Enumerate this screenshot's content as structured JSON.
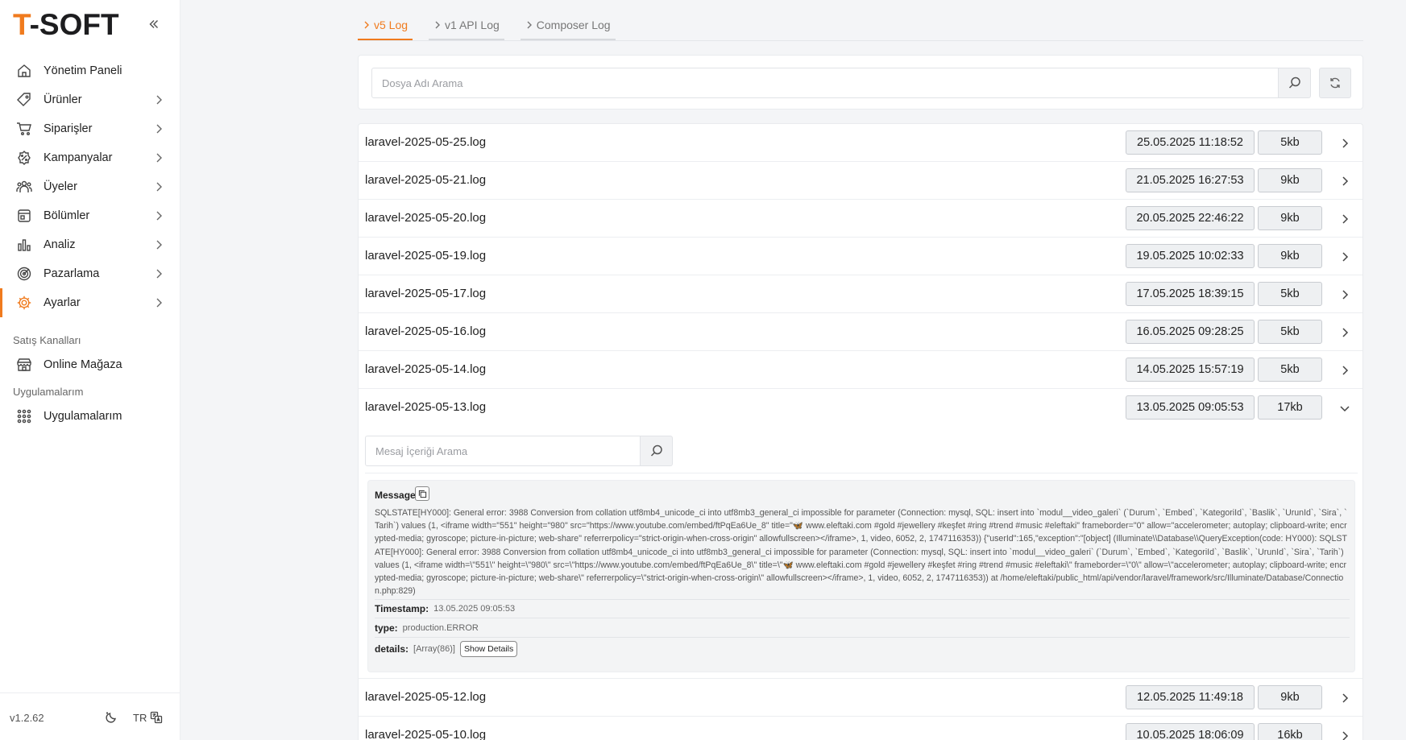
{
  "brand": {
    "logo_accent": "T",
    "logo_rest": "-SOFT",
    "accent_color": "#f07b1e"
  },
  "sidebar": {
    "items": [
      {
        "label": "Yönetim Paneli",
        "icon": "home-icon",
        "has_children": false
      },
      {
        "label": "Ürünler",
        "icon": "tag-icon",
        "has_children": true
      },
      {
        "label": "Siparişler",
        "icon": "cart-icon",
        "has_children": true
      },
      {
        "label": "Kampanyalar",
        "icon": "discount-icon",
        "has_children": true
      },
      {
        "label": "Üyeler",
        "icon": "users-icon",
        "has_children": true
      },
      {
        "label": "Bölümler",
        "icon": "sections-icon",
        "has_children": true
      },
      {
        "label": "Analiz",
        "icon": "chart-icon",
        "has_children": true
      },
      {
        "label": "Pazarlama",
        "icon": "target-icon",
        "has_children": true
      },
      {
        "label": "Ayarlar",
        "icon": "gear-icon",
        "has_children": true,
        "active": true
      }
    ],
    "sales_channels_label": "Satış Kanalları",
    "online_store_label": "Online Mağaza",
    "apps_section_label": "Uygulamalarım",
    "apps_item_label": "Uygulamalarım",
    "version": "v1.2.62",
    "language": "TR"
  },
  "tabs": [
    {
      "label": "v5 Log",
      "active": true
    },
    {
      "label": "v1 API Log",
      "active": false
    },
    {
      "label": "Composer Log",
      "active": false
    }
  ],
  "search": {
    "placeholder": "Dosya Adı Arama"
  },
  "logs": [
    {
      "name": "laravel-2025-05-25.log",
      "date": "25.05.2025 11:18:52",
      "size": "5kb"
    },
    {
      "name": "laravel-2025-05-21.log",
      "date": "21.05.2025 16:27:53",
      "size": "9kb"
    },
    {
      "name": "laravel-2025-05-20.log",
      "date": "20.05.2025 22:46:22",
      "size": "9kb"
    },
    {
      "name": "laravel-2025-05-19.log",
      "date": "19.05.2025 10:02:33",
      "size": "9kb"
    },
    {
      "name": "laravel-2025-05-17.log",
      "date": "17.05.2025 18:39:15",
      "size": "5kb"
    },
    {
      "name": "laravel-2025-05-16.log",
      "date": "16.05.2025 09:28:25",
      "size": "5kb"
    },
    {
      "name": "laravel-2025-05-14.log",
      "date": "14.05.2025 15:57:19",
      "size": "5kb"
    },
    {
      "name": "laravel-2025-05-13.log",
      "date": "13.05.2025 09:05:53",
      "size": "17kb",
      "expanded": true
    },
    {
      "name": "laravel-2025-05-12.log",
      "date": "12.05.2025 11:49:18",
      "size": "9kb"
    },
    {
      "name": "laravel-2025-05-10.log",
      "date": "10.05.2025 18:06:09",
      "size": "16kb"
    }
  ],
  "expanded_entry": {
    "search_placeholder": "Mesaj İçeriği Arama",
    "message_label": "Message",
    "message": "SQLSTATE[HY000]: General error: 3988 Conversion from collation utf8mb4_unicode_ci into utf8mb3_general_ci impossible for parameter (Connection: mysql, SQL: insert into `modul__video_galeri` (`Durum`, `Embed`, `KategoriId`, `Baslik`, `UrunId`, `Sira`, `Tarih`) values (1, <iframe width=\"551\" height=\"980\" src=\"https://www.youtube.com/embed/ftPqEa6Ue_8\" title=\"🦋 www.eleftaki.com #gold #jewellery #keşfet #ring #trend #music #eleftaki\" frameborder=\"0\" allow=\"accelerometer; autoplay; clipboard-write; encrypted-media; gyroscope; picture-in-picture; web-share\" referrerpolicy=\"strict-origin-when-cross-origin\" allowfullscreen></iframe>, 1, video, 6052, 2, 1747116353)) {\"userId\":165,\"exception\":\"[object] (Illuminate\\\\Database\\\\QueryException(code: HY000): SQLSTATE[HY000]: General error: 3988 Conversion from collation utf8mb4_unicode_ci into utf8mb3_general_ci impossible for parameter (Connection: mysql, SQL: insert into `modul__video_galeri` (`Durum`, `Embed`, `KategoriId`, `Baslik`, `UrunId`, `Sira`, `Tarih`) values (1, <iframe width=\\\"551\\\" height=\\\"980\\\" src=\\\"https://www.youtube.com/embed/ftPqEa6Ue_8\\\" title=\\\"🦋 www.eleftaki.com #gold #jewellery #keşfet #ring #trend #music #eleftaki\\\" frameborder=\\\"0\\\" allow=\\\"accelerometer; autoplay; clipboard-write; encrypted-media; gyroscope; picture-in-picture; web-share\\\" referrerpolicy=\\\"strict-origin-when-cross-origin\\\" allowfullscreen></iframe>, 1, video, 6052, 2, 1747116353)) at /home/eleftaki/public_html/api/vendor/laravel/framework/src/Illuminate/Database/Connection.php:829)",
    "timestamp_label": "Timestamp:",
    "timestamp": "13.05.2025 09:05:53",
    "type_label": "type:",
    "type": "production.ERROR",
    "details_label": "details:",
    "details": "[Array(86)]",
    "show_details_label": "Show Details"
  }
}
